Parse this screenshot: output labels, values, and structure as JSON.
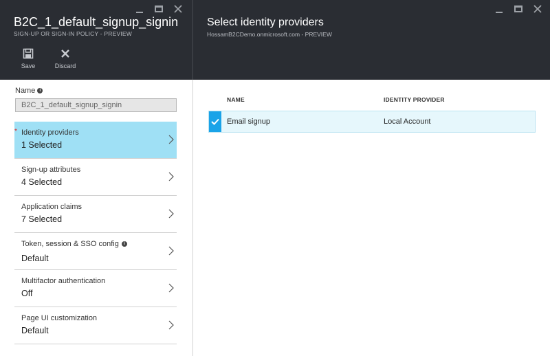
{
  "left_blade": {
    "title": "B2C_1_default_signup_signin",
    "subtitle": "SIGN-UP OR SIGN-IN POLICY - PREVIEW",
    "commands": [
      {
        "label": "Save",
        "icon": "save-icon"
      },
      {
        "label": "Discard",
        "icon": "close-icon"
      }
    ],
    "name_label": "Name",
    "name_value": "B2C_1_default_signup_signin",
    "items": [
      {
        "title": "Identity providers",
        "value": "1 Selected",
        "required": true,
        "selected": true,
        "info": false
      },
      {
        "title": "Sign-up attributes",
        "value": "4 Selected",
        "required": false,
        "selected": false,
        "info": false
      },
      {
        "title": "Application claims",
        "value": "7 Selected",
        "required": false,
        "selected": false,
        "info": false
      },
      {
        "title": "Token, session & SSO config",
        "value": "Default",
        "required": false,
        "selected": false,
        "info": true
      },
      {
        "title": "Multifactor authentication",
        "value": "Off",
        "required": false,
        "selected": false,
        "info": false
      },
      {
        "title": "Page UI customization",
        "value": "Default",
        "required": false,
        "selected": false,
        "info": false
      }
    ]
  },
  "right_blade": {
    "title": "Select identity providers",
    "subtitle": "HossamB2CDemo.onmicrosoft.com - PREVIEW",
    "columns": [
      "NAME",
      "IDENTITY PROVIDER"
    ],
    "rows": [
      {
        "name": "Email signup",
        "provider": "Local Account",
        "checked": true
      }
    ]
  },
  "colors": {
    "header_bg": "#2a2d33",
    "selected_item": "#9fe0f5",
    "row_bg": "#e6f7fc",
    "check_bg": "#1aa3e8",
    "required": "#dd2222"
  }
}
